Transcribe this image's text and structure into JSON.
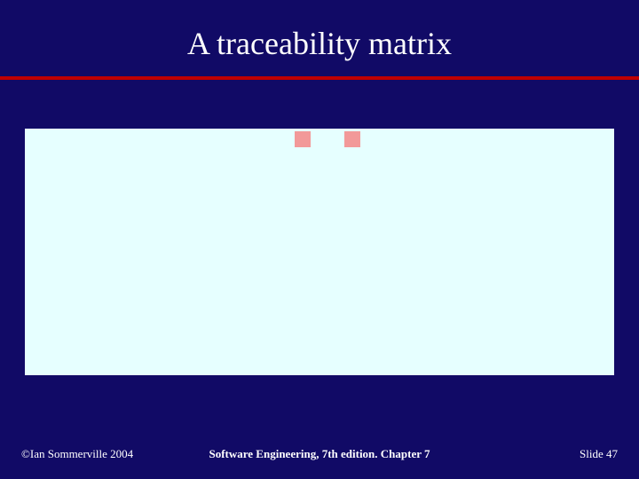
{
  "slide": {
    "title": "A traceability matrix"
  },
  "footer": {
    "copyright": "©Ian Sommerville 2004",
    "center": "Software Engineering, 7th edition. Chapter 7",
    "slide_label": "Slide 47"
  },
  "colors": {
    "background": "#110a66",
    "rule": "#c00000",
    "panel": "#e6ffff",
    "marker": "#f29999"
  }
}
